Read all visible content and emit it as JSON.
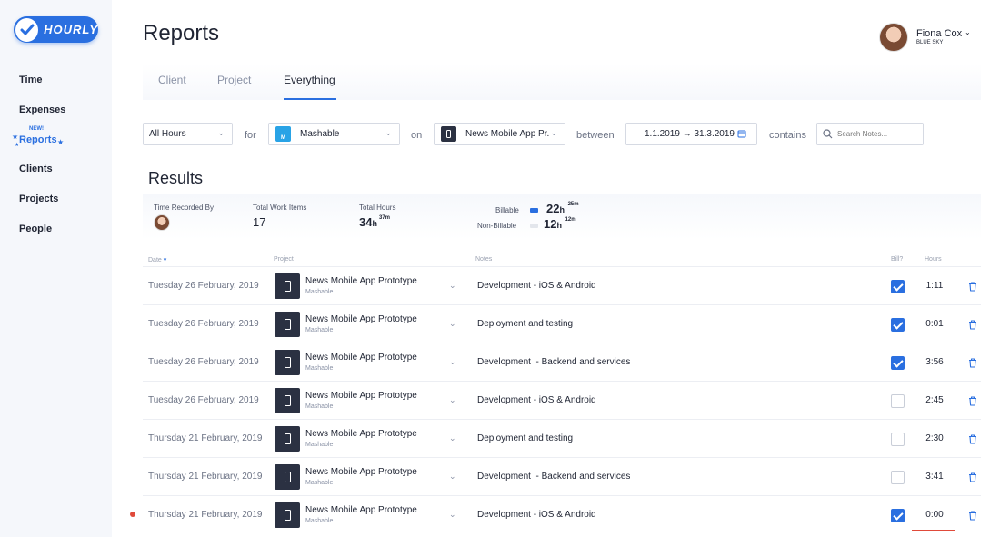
{
  "app": {
    "logo_text": "HOURLY",
    "accent": "#2a6fe0"
  },
  "sidebar": {
    "items": [
      {
        "label": "Time"
      },
      {
        "label": "Expenses"
      },
      {
        "label": "Reports",
        "badge": "NEW!",
        "active": true
      },
      {
        "label": "Clients"
      },
      {
        "label": "Projects"
      },
      {
        "label": "People"
      }
    ]
  },
  "header": {
    "title": "Reports"
  },
  "user": {
    "name": "Fiona Cox",
    "org": "BLUE SKY"
  },
  "tabs": [
    {
      "label": "Client"
    },
    {
      "label": "Project"
    },
    {
      "label": "Everything",
      "active": true
    }
  ],
  "filters": {
    "hours": "All Hours",
    "for_label": "for",
    "client": "Mashable",
    "client_icon_letter": "M",
    "on_label": "on",
    "project": "News Mobile App Pr...",
    "between_label": "between",
    "date_range": "1.1.2019 → 31.3.2019",
    "contains_label": "contains",
    "search_placeholder": "Search Notes..."
  },
  "results": {
    "title": "Results",
    "time_recorded_by_label": "Time Recorded By",
    "total_work_items_label": "Total Work Items",
    "total_work_items": "17",
    "total_hours_label": "Total Hours",
    "total_hours_h": "34",
    "total_hours_unit": "h",
    "total_hours_m": "37m",
    "billable_label": "Billable",
    "billable_h": "22",
    "billable_unit": "h",
    "billable_m": "25m",
    "non_billable_label": "Non-Billable",
    "non_billable_h": "12",
    "non_billable_unit": "h",
    "non_billable_m": "12m"
  },
  "table": {
    "headers": {
      "date": "Date",
      "project": "Project",
      "notes": "Notes",
      "bill": "Bill?",
      "hours": "Hours"
    },
    "rows": [
      {
        "date": "Tuesday 26 February, 2019",
        "project": "News Mobile App Prototype",
        "client": "Mashable",
        "notes": "Development - iOS & Android",
        "billable": true,
        "hours": "1:11"
      },
      {
        "date": "Tuesday 26 February, 2019",
        "project": "News Mobile App Prototype",
        "client": "Mashable",
        "notes": "Deployment and testing",
        "billable": true,
        "hours": "0:01"
      },
      {
        "date": "Tuesday 26 February, 2019",
        "project": "News Mobile App Prototype",
        "client": "Mashable",
        "notes": "Development  - Backend and services",
        "billable": true,
        "hours": "3:56"
      },
      {
        "date": "Tuesday 26 February, 2019",
        "project": "News Mobile App Prototype",
        "client": "Mashable",
        "notes": "Development - iOS & Android",
        "billable": false,
        "hours": "2:45"
      },
      {
        "date": "Thursday 21 February, 2019",
        "project": "News Mobile App Prototype",
        "client": "Mashable",
        "notes": "Deployment and testing",
        "billable": false,
        "hours": "2:30"
      },
      {
        "date": "Thursday 21 February, 2019",
        "project": "News Mobile App Prototype",
        "client": "Mashable",
        "notes": "Development  - Backend and services",
        "billable": false,
        "hours": "3:41"
      },
      {
        "date": "Thursday 21 February, 2019",
        "project": "News Mobile App Prototype",
        "client": "Mashable",
        "notes": "Development - iOS & Android",
        "billable": true,
        "hours": "0:00"
      }
    ]
  }
}
